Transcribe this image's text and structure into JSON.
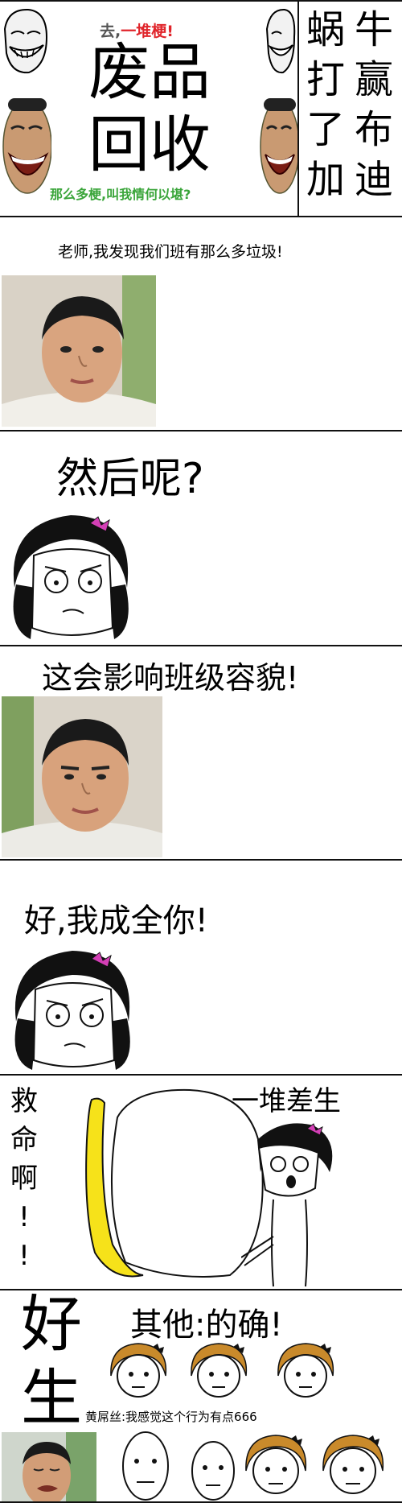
{
  "colors": {
    "title_red": "#e0242a",
    "subtitle_green": "#3aa53a",
    "banana_yellow": "#f6e21a",
    "skin": "#e7c2a0",
    "photo_bg_green": "#7fa05f",
    "girl_hair": "#c98a2b",
    "bow_pink": "#d43fb6"
  },
  "panel1": {
    "top_line_prefix": "去,",
    "top_line_emphasis": "一堆梗!",
    "title_line1": "废品",
    "title_line2": "回收",
    "subtitle": "那么多梗,叫我情何以堪?",
    "side_columns": [
      [
        "蜗",
        "打",
        "了",
        "加"
      ],
      [
        "牛",
        "赢",
        "布",
        "迪"
      ]
    ],
    "icons": [
      "troll-face-icon",
      "yao-ming-laugh-icon"
    ]
  },
  "panel2": {
    "text": "老师,我发现我们班有那么多垃圾!",
    "icons": [
      "student-photo"
    ]
  },
  "panel3": {
    "text": "然后呢?",
    "icons": [
      "teacher-rage-face-icon"
    ]
  },
  "panel4": {
    "text": "这会影响班级容貌!",
    "icons": [
      "student-photo"
    ]
  },
  "panel5": {
    "text": "好,我成全你!",
    "icons": [
      "teacher-rage-face-icon"
    ]
  },
  "panel6": {
    "left_vertical": [
      "救",
      "命",
      "啊",
      "!",
      "!"
    ],
    "label": "一堆差生",
    "icons": [
      "banana-icon",
      "trash-bag-icon",
      "teacher-rage-face-icon"
    ]
  },
  "panel7": {
    "big_char1": "好",
    "big_char2": "生",
    "others_text": "其他:的确!",
    "caption": "黄屌丝:我感觉这个行为有点666",
    "icons": [
      "student-cry-photo",
      "rage-girl-face-icon",
      "poker-face-icon"
    ]
  }
}
